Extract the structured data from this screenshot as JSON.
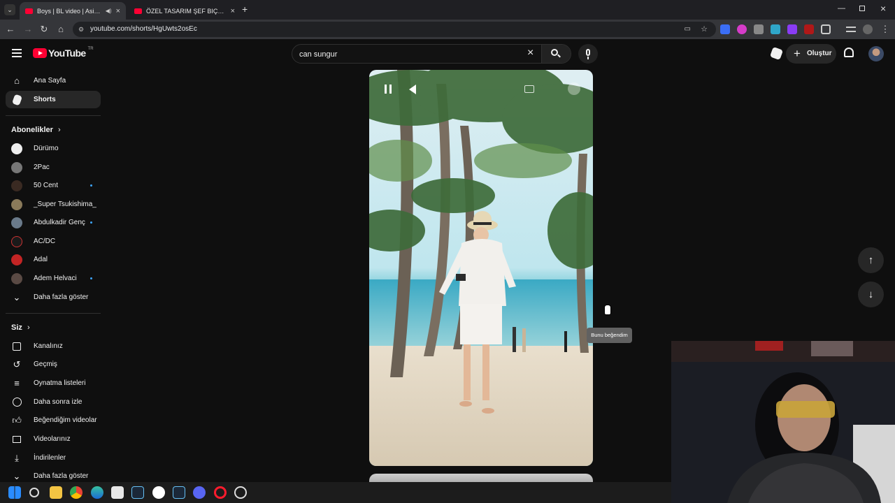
{
  "browser": {
    "tabs": [
      {
        "title": "Boys | BL video | Asian Men",
        "active": true
      },
      {
        "title": "ÖZEL TASARIM ŞEF BIÇAĞINI İN",
        "active": false
      }
    ],
    "url": "youtube.com/shorts/HgUwts2osEc"
  },
  "header": {
    "logo_text": "YouTube",
    "logo_region": "TR",
    "search_value": "can sungur",
    "create_label": "Oluştur"
  },
  "sidebar": {
    "main": [
      {
        "label": "Ana Sayfa",
        "icon": "home-icon"
      },
      {
        "label": "Shorts",
        "icon": "shorts-icon",
        "active": true
      }
    ],
    "subs_title": "Abonelikler",
    "subs": [
      {
        "label": "Dürümo",
        "new": false
      },
      {
        "label": "2Pac",
        "new": false
      },
      {
        "label": "50 Cent",
        "new": true
      },
      {
        "label": "_Super Tsukishima_",
        "new": false
      },
      {
        "label": "Abdulkadir Genç",
        "new": true
      },
      {
        "label": "AC/DC",
        "new": false
      },
      {
        "label": "Adal",
        "new": false
      },
      {
        "label": "Adem Helvaci",
        "new": true
      }
    ],
    "subs_more": "Daha fazla göster",
    "you_title": "Siz",
    "you": [
      {
        "label": "Kanalınız",
        "icon": "channel-icon"
      },
      {
        "label": "Geçmiş",
        "icon": "history-icon"
      },
      {
        "label": "Oynatma listeleri",
        "icon": "playlists-icon"
      },
      {
        "label": "Daha sonra izle",
        "icon": "watch-later-icon"
      },
      {
        "label": "Beğendiğim videolar",
        "icon": "liked-icon"
      },
      {
        "label": "Videolarınız",
        "icon": "your-videos-icon"
      },
      {
        "label": "İndirilenler",
        "icon": "downloads-icon"
      }
    ],
    "you_more": "Daha fazla göster"
  },
  "tooltip": "Bunu beğendim",
  "colors": {
    "accent": "#ff0033",
    "bg": "#0f0f0f",
    "link": "#3ea6ff"
  }
}
